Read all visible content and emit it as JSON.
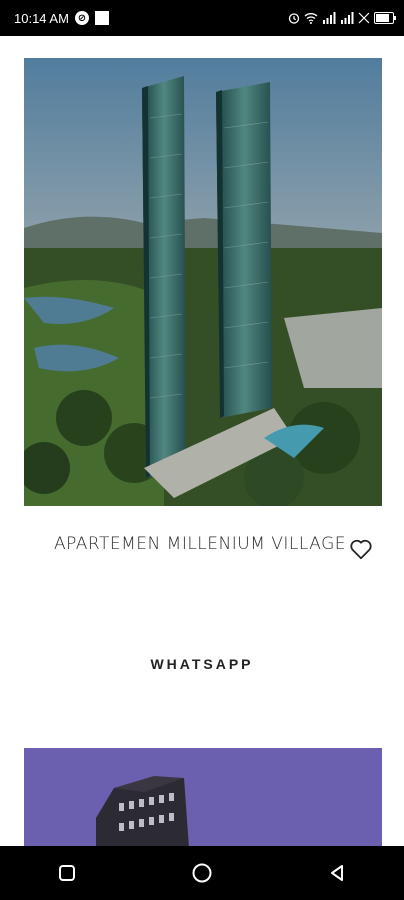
{
  "status_bar": {
    "time": "10:14 AM",
    "dnd_glyph": "⊘"
  },
  "listing": {
    "title": "APARTEMEN MILLENIUM VILLAGE",
    "image_icon": "tower-photo",
    "favorite_icon": "heart-outline-icon"
  },
  "actions": {
    "whatsapp_label": "WHATSAPP"
  },
  "colors": {
    "background": "#ffffff",
    "system_bars": "#000000",
    "text": "#2b2b2b",
    "next_card_sky": "#6b5fb0"
  }
}
